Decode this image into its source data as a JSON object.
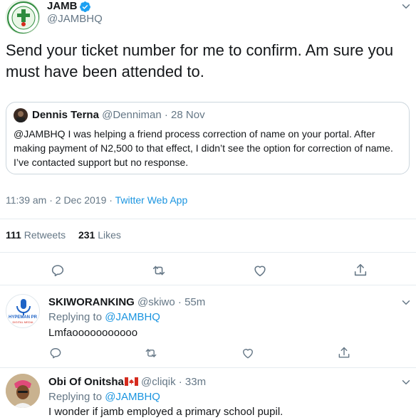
{
  "main_tweet": {
    "author_name": "JAMB",
    "author_handle": "@JAMBHQ",
    "verified_icon": "verified-badge-icon",
    "text": "Send your ticket number for me to confirm. Am sure you must have been attended to.",
    "quoted": {
      "author_name": "Dennis Terna",
      "author_handle": "@Denniman",
      "separator": "·",
      "date": "28 Nov",
      "text": "@JAMBHQ I was helping a friend process correction of name on your portal. After making payment of N2,500 to that effect, I didn’t see the option for correction of name. I’ve contacted support but no response."
    },
    "time": "11:39 am · 2 Dec 2019 · ",
    "source": "Twitter Web App",
    "retweets_count": "111",
    "retweets_label": "Retweets",
    "likes_count": "231",
    "likes_label": "Likes"
  },
  "replies": [
    {
      "author_name": "SKIWORANKING",
      "author_handle": "@skiwo",
      "time": "· 55m",
      "replying_prefix": "Replying to ",
      "replying_to": "@JAMBHQ",
      "text": "Lmfaooooooooooo",
      "avatar_text": "HYPEMAN PR",
      "avatar_subtext": "DIGITAL MEDIA"
    },
    {
      "author_name": "Obi Of Onitsha",
      "flag": "🇨🇦",
      "author_handle": "@cliqik",
      "time": "· 33m",
      "replying_prefix": "Replying to ",
      "replying_to": "@JAMBHQ",
      "text": "I wonder if jamb employed a primary school pupil."
    }
  ],
  "colors": {
    "accent": "#1b95e0",
    "muted": "#657786",
    "text": "#14171a",
    "border": "#e6ecf0",
    "flag_red": "#d52b1e"
  },
  "icons": [
    "reply-icon",
    "retweet-icon",
    "like-icon",
    "share-icon",
    "chevron-down-icon",
    "verified-badge-icon"
  ]
}
